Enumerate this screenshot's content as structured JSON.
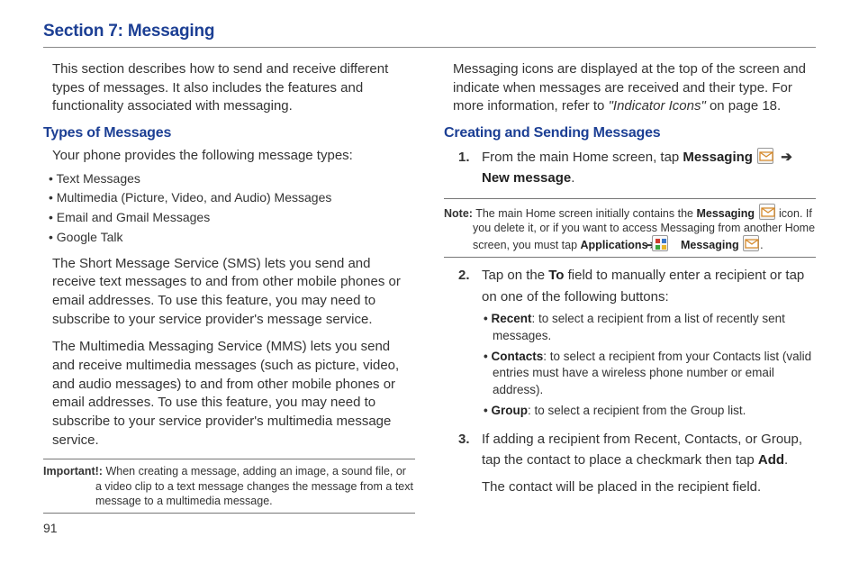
{
  "section_title": "Section 7: Messaging",
  "left": {
    "intro": "This section describes how to send and receive different types of messages. It also includes the features and functionality associated with messaging.",
    "subhead": "Types of Messages",
    "lead": "Your phone provides the following message types:",
    "bullets": [
      "Text Messages",
      "Multimedia (Picture, Video, and Audio) Messages",
      "Email and Gmail Messages",
      "Google Talk"
    ],
    "sms": "The Short Message Service (SMS) lets you send and receive text messages to and from other mobile phones or email addresses. To use this feature, you may need to subscribe to your service provider's message service.",
    "mms": "The Multimedia Messaging Service (MMS) lets you send and receive multimedia messages (such as picture, video, and audio messages) to and from other mobile phones or email addresses. To use this feature, you may need to subscribe to your service provider's multimedia message service.",
    "important_label": "Important!:",
    "important_text": " When creating a message, adding an image, a sound file, or a video clip to a text message changes the message from a text message to a multimedia message.",
    "pagenum": "91"
  },
  "right": {
    "icons_para_a": "Messaging icons are displayed at the top of the screen and indicate when messages are received and their type. For more information, refer to ",
    "icons_ref": "\"Indicator Icons\"",
    "icons_para_b": "  on page 18.",
    "subhead": "Creating and Sending Messages",
    "step1_a": "From the main Home screen, tap ",
    "step1_b": "Messaging",
    "step1_c": "New message",
    "note_label": "Note:",
    "note_a": " The main Home screen initially contains the ",
    "note_b": "Messaging",
    "note_c": " icon. If you delete it, or if you want to access Messaging from another Home screen, you must tap ",
    "note_d": "Applications",
    "note_e": "Messaging",
    "step2_a": "Tap on the ",
    "step2_b": "To",
    "step2_c": " field to manually enter a recipient or tap on one of the following buttons:",
    "sub": [
      {
        "head": "Recent",
        "tail": ": to select a recipient from a list of recently sent messages."
      },
      {
        "head": "Contacts",
        "tail": ": to select a recipient from your Contacts list (valid entries must have a wireless phone number or email address)."
      },
      {
        "head": "Group",
        "tail": ": to select a recipient from the Group list."
      }
    ],
    "step3_a": "If adding a recipient from Recent, Contacts, or Group, tap the contact to place a checkmark then tap ",
    "step3_b": "Add",
    "step3_extra": "The contact will be placed in the recipient field."
  }
}
